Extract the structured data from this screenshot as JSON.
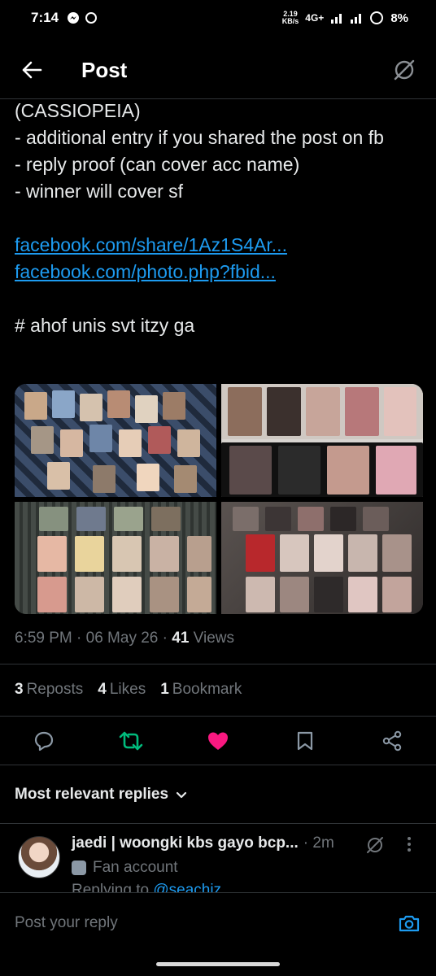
{
  "status": {
    "time": "7:14",
    "net_speed": "2.19",
    "net_unit": "KB/s",
    "network": "4G+",
    "battery": "8%"
  },
  "header": {
    "title": "Post"
  },
  "tweet": {
    "lines": [
      "(CASSIOPEIA)",
      "- additional entry if you shared the post on fb",
      "- reply proof (can cover acc name)",
      "- winner will cover sf"
    ],
    "links": [
      "facebook.com/share/1Az1S4Ar...",
      "facebook.com/photo.php?fbid..."
    ],
    "hashtags": "# ahof unis svt itzy ga"
  },
  "meta": {
    "time_date": "6:59 PM · 06 May 26 · ",
    "views_count": "41",
    "views_label": " Views"
  },
  "stats": {
    "reposts_count": "3",
    "reposts_label": "Reposts",
    "likes_count": "4",
    "likes_label": "Likes",
    "bookmarks_count": "1",
    "bookmarks_label": "Bookmark"
  },
  "actions": {
    "liked": true,
    "reposted": true,
    "like_color": "#f91880",
    "repost_color": "#00ba7c"
  },
  "replies": {
    "sort_label": "Most relevant replies",
    "items": [
      {
        "name": "jaedi | woongki kbs gayo bcp...",
        "time": "· 2m",
        "badge": "Fan account",
        "replying_prefix": "Replying to ",
        "replying_handle": "@seachiz"
      }
    ]
  },
  "composer": {
    "placeholder": "Post your reply"
  }
}
